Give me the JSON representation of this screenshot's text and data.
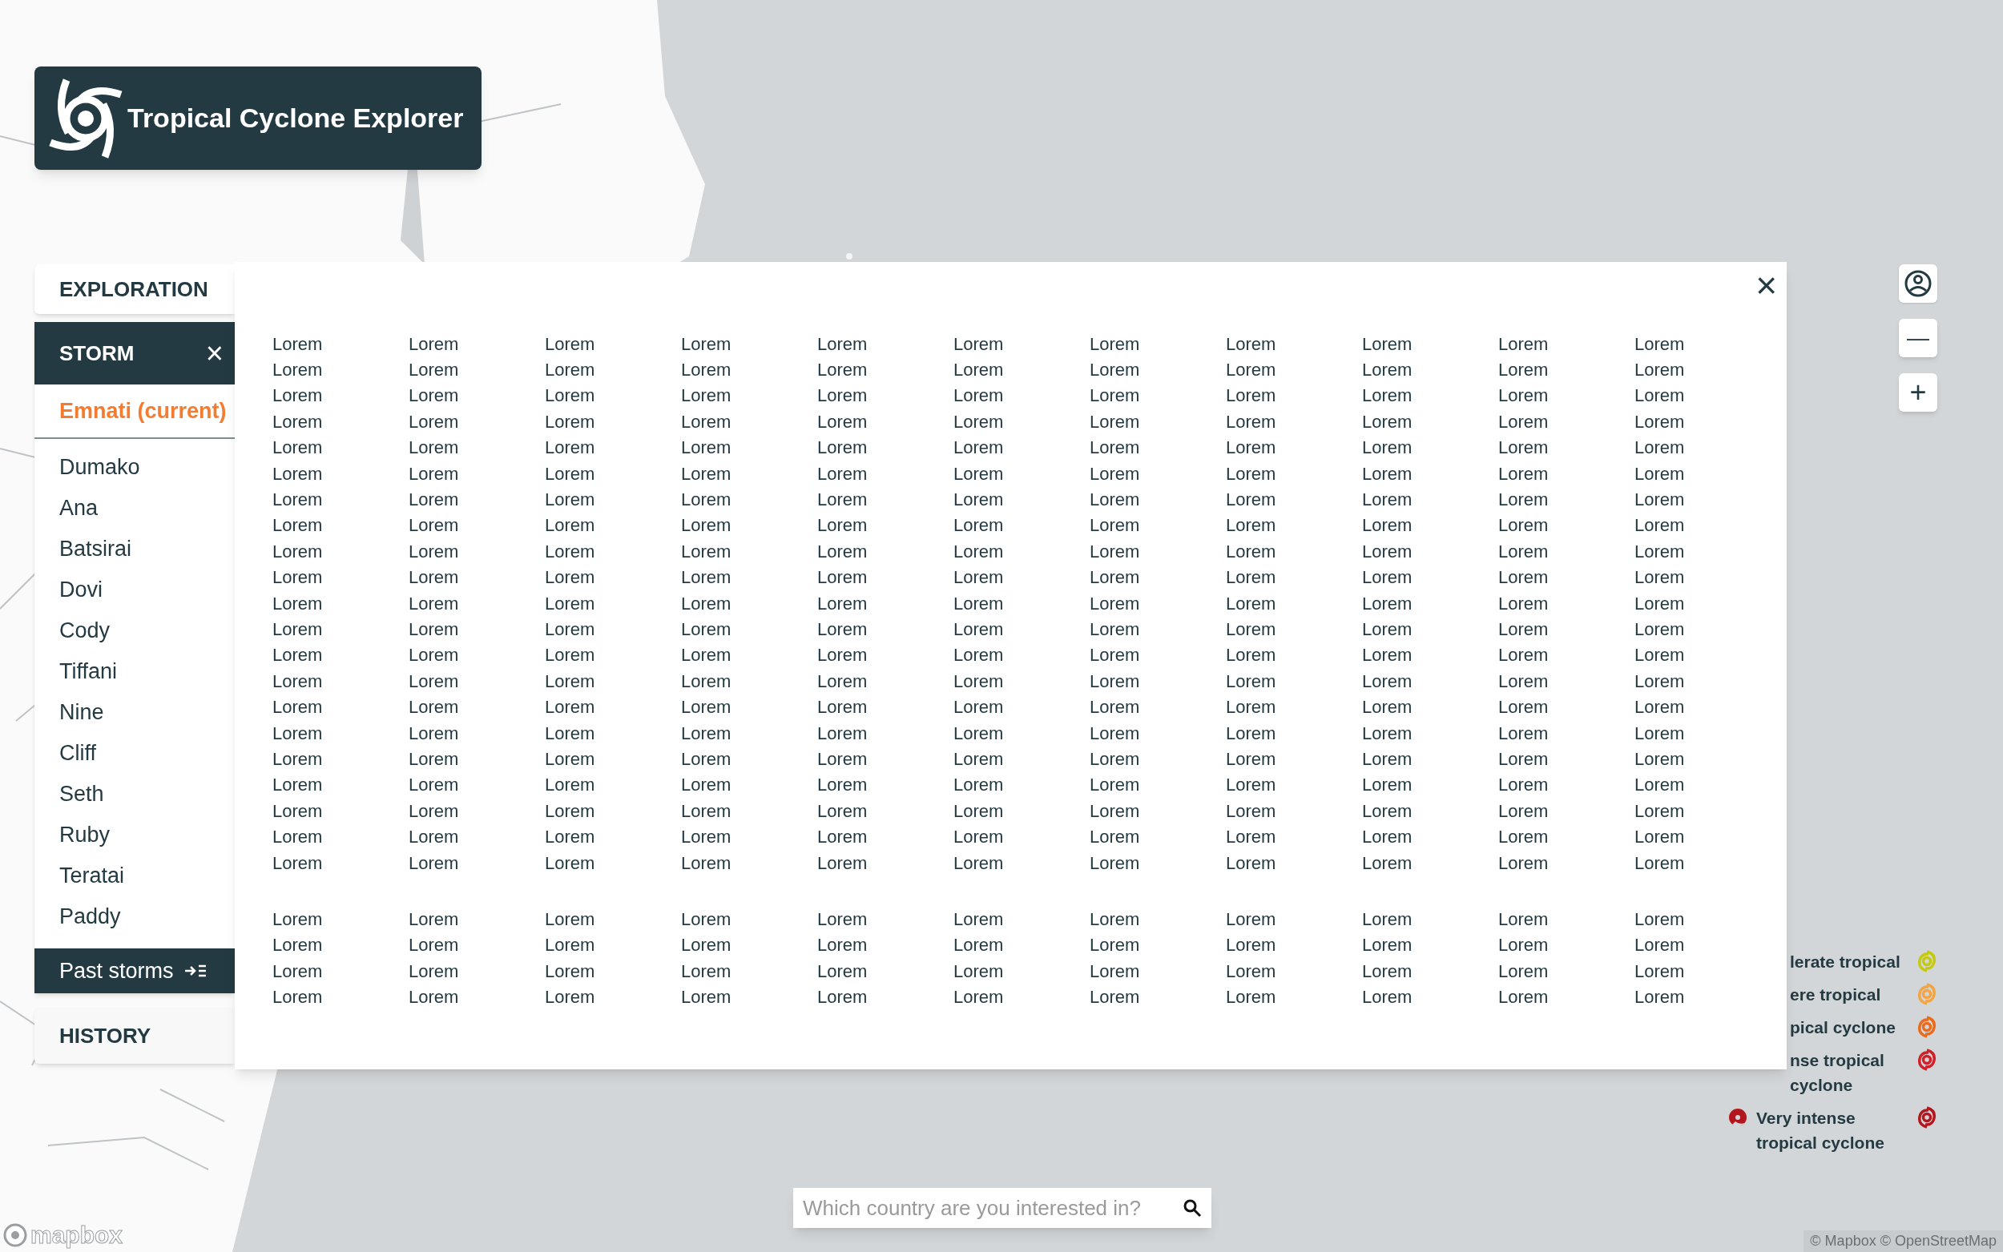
{
  "header": {
    "title": "Tropical Cyclone Explorer"
  },
  "sidebar": {
    "exploration_tab": "EXPLORATION",
    "storm_panel": {
      "title": "STORM",
      "close": "×",
      "storms": [
        {
          "name": "Emnati (current)",
          "selected": true
        },
        {
          "name": "Dumako",
          "selected": false
        },
        {
          "name": "Ana",
          "selected": false
        },
        {
          "name": "Batsirai",
          "selected": false
        },
        {
          "name": "Dovi",
          "selected": false
        },
        {
          "name": "Cody",
          "selected": false
        },
        {
          "name": "Tiffani",
          "selected": false
        },
        {
          "name": "Nine",
          "selected": false
        },
        {
          "name": "Cliff",
          "selected": false
        },
        {
          "name": "Seth",
          "selected": false
        },
        {
          "name": "Ruby",
          "selected": false
        },
        {
          "name": "Teratai",
          "selected": false
        },
        {
          "name": "Paddy",
          "selected": false
        }
      ],
      "past_storms_button": "Past storms"
    },
    "history_tab": "HISTORY"
  },
  "modal": {
    "close": "×",
    "sections": [
      {
        "rows": [
          [
            "Lorem",
            "Lorem",
            "Lorem",
            "Lorem",
            "Lorem",
            "Lorem",
            "Lorem",
            "Lorem",
            "Lorem",
            "Lorem",
            "Lorem"
          ],
          [
            "Lorem",
            "Lorem",
            "Lorem",
            "Lorem",
            "Lorem",
            "Lorem",
            "Lorem",
            "Lorem",
            "Lorem",
            "Lorem",
            "Lorem"
          ],
          [
            "Lorem",
            "Lorem",
            "Lorem",
            "Lorem",
            "Lorem",
            "Lorem",
            "Lorem",
            "Lorem",
            "Lorem",
            "Lorem",
            "Lorem"
          ],
          [
            "Lorem",
            "Lorem",
            "Lorem",
            "Lorem",
            "Lorem",
            "Lorem",
            "Lorem",
            "Lorem",
            "Lorem",
            "Lorem",
            "Lorem"
          ],
          [
            "Lorem",
            "Lorem",
            "Lorem",
            "Lorem",
            "Lorem",
            "Lorem",
            "Lorem",
            "Lorem",
            "Lorem",
            "Lorem",
            "Lorem"
          ],
          [
            "Lorem",
            "Lorem",
            "Lorem",
            "Lorem",
            "Lorem",
            "Lorem",
            "Lorem",
            "Lorem",
            "Lorem",
            "Lorem",
            "Lorem"
          ],
          [
            "Lorem",
            "Lorem",
            "Lorem",
            "Lorem",
            "Lorem",
            "Lorem",
            "Lorem",
            "Lorem",
            "Lorem",
            "Lorem",
            "Lorem"
          ],
          [
            "Lorem",
            "Lorem",
            "Lorem",
            "Lorem",
            "Lorem",
            "Lorem",
            "Lorem",
            "Lorem",
            "Lorem",
            "Lorem",
            "Lorem"
          ],
          [
            "Lorem",
            "Lorem",
            "Lorem",
            "Lorem",
            "Lorem",
            "Lorem",
            "Lorem",
            "Lorem",
            "Lorem",
            "Lorem",
            "Lorem"
          ],
          [
            "Lorem",
            "Lorem",
            "Lorem",
            "Lorem",
            "Lorem",
            "Lorem",
            "Lorem",
            "Lorem",
            "Lorem",
            "Lorem",
            "Lorem"
          ],
          [
            "Lorem",
            "Lorem",
            "Lorem",
            "Lorem",
            "Lorem",
            "Lorem",
            "Lorem",
            "Lorem",
            "Lorem",
            "Lorem",
            "Lorem"
          ],
          [
            "Lorem",
            "Lorem",
            "Lorem",
            "Lorem",
            "Lorem",
            "Lorem",
            "Lorem",
            "Lorem",
            "Lorem",
            "Lorem",
            "Lorem"
          ],
          [
            "Lorem",
            "Lorem",
            "Lorem",
            "Lorem",
            "Lorem",
            "Lorem",
            "Lorem",
            "Lorem",
            "Lorem",
            "Lorem",
            "Lorem"
          ],
          [
            "Lorem",
            "Lorem",
            "Lorem",
            "Lorem",
            "Lorem",
            "Lorem",
            "Lorem",
            "Lorem",
            "Lorem",
            "Lorem",
            "Lorem"
          ],
          [
            "Lorem",
            "Lorem",
            "Lorem",
            "Lorem",
            "Lorem",
            "Lorem",
            "Lorem",
            "Lorem",
            "Lorem",
            "Lorem",
            "Lorem"
          ],
          [
            "Lorem",
            "Lorem",
            "Lorem",
            "Lorem",
            "Lorem",
            "Lorem",
            "Lorem",
            "Lorem",
            "Lorem",
            "Lorem",
            "Lorem"
          ],
          [
            "Lorem",
            "Lorem",
            "Lorem",
            "Lorem",
            "Lorem",
            "Lorem",
            "Lorem",
            "Lorem",
            "Lorem",
            "Lorem",
            "Lorem"
          ],
          [
            "Lorem",
            "Lorem",
            "Lorem",
            "Lorem",
            "Lorem",
            "Lorem",
            "Lorem",
            "Lorem",
            "Lorem",
            "Lorem",
            "Lorem"
          ],
          [
            "Lorem",
            "Lorem",
            "Lorem",
            "Lorem",
            "Lorem",
            "Lorem",
            "Lorem",
            "Lorem",
            "Lorem",
            "Lorem",
            "Lorem"
          ],
          [
            "Lorem",
            "Lorem",
            "Lorem",
            "Lorem",
            "Lorem",
            "Lorem",
            "Lorem",
            "Lorem",
            "Lorem",
            "Lorem",
            "Lorem"
          ],
          [
            "Lorem",
            "Lorem",
            "Lorem",
            "Lorem",
            "Lorem",
            "Lorem",
            "Lorem",
            "Lorem",
            "Lorem",
            "Lorem",
            "Lorem"
          ]
        ]
      },
      {
        "rows": [
          [
            "Lorem",
            "Lorem",
            "Lorem",
            "Lorem",
            "Lorem",
            "Lorem",
            "Lorem",
            "Lorem",
            "Lorem",
            "Lorem",
            "Lorem"
          ],
          [
            "Lorem",
            "Lorem",
            "Lorem",
            "Lorem",
            "Lorem",
            "Lorem",
            "Lorem",
            "Lorem",
            "Lorem",
            "Lorem",
            "Lorem"
          ],
          [
            "Lorem",
            "Lorem",
            "Lorem",
            "Lorem",
            "Lorem",
            "Lorem",
            "Lorem",
            "Lorem",
            "Lorem",
            "Lorem",
            "Lorem"
          ],
          [
            "Lorem",
            "Lorem",
            "Lorem",
            "Lorem",
            "Lorem",
            "Lorem",
            "Lorem",
            "Lorem",
            "Lorem",
            "Lorem",
            "Lorem"
          ]
        ]
      }
    ]
  },
  "map_controls": {
    "zoom_out": "—",
    "zoom_in": "+"
  },
  "legend": [
    {
      "label": "lerate tropical",
      "color": "#c5c90f",
      "marker": false
    },
    {
      "label": "ere tropical",
      "color": "#f5a442",
      "marker": false
    },
    {
      "label": "pical cyclone",
      "color": "#ec6a1c",
      "marker": false
    },
    {
      "label": "nse tropical cyclone",
      "color": "#d21f28",
      "marker": false
    },
    {
      "label": "Very intense tropical cyclone",
      "color": "#b3171d",
      "marker": true
    }
  ],
  "search": {
    "placeholder": "Which country are you interested in?"
  },
  "attribution": {
    "logo": "mapbox",
    "text": "© Mapbox © OpenStreetMap"
  }
}
